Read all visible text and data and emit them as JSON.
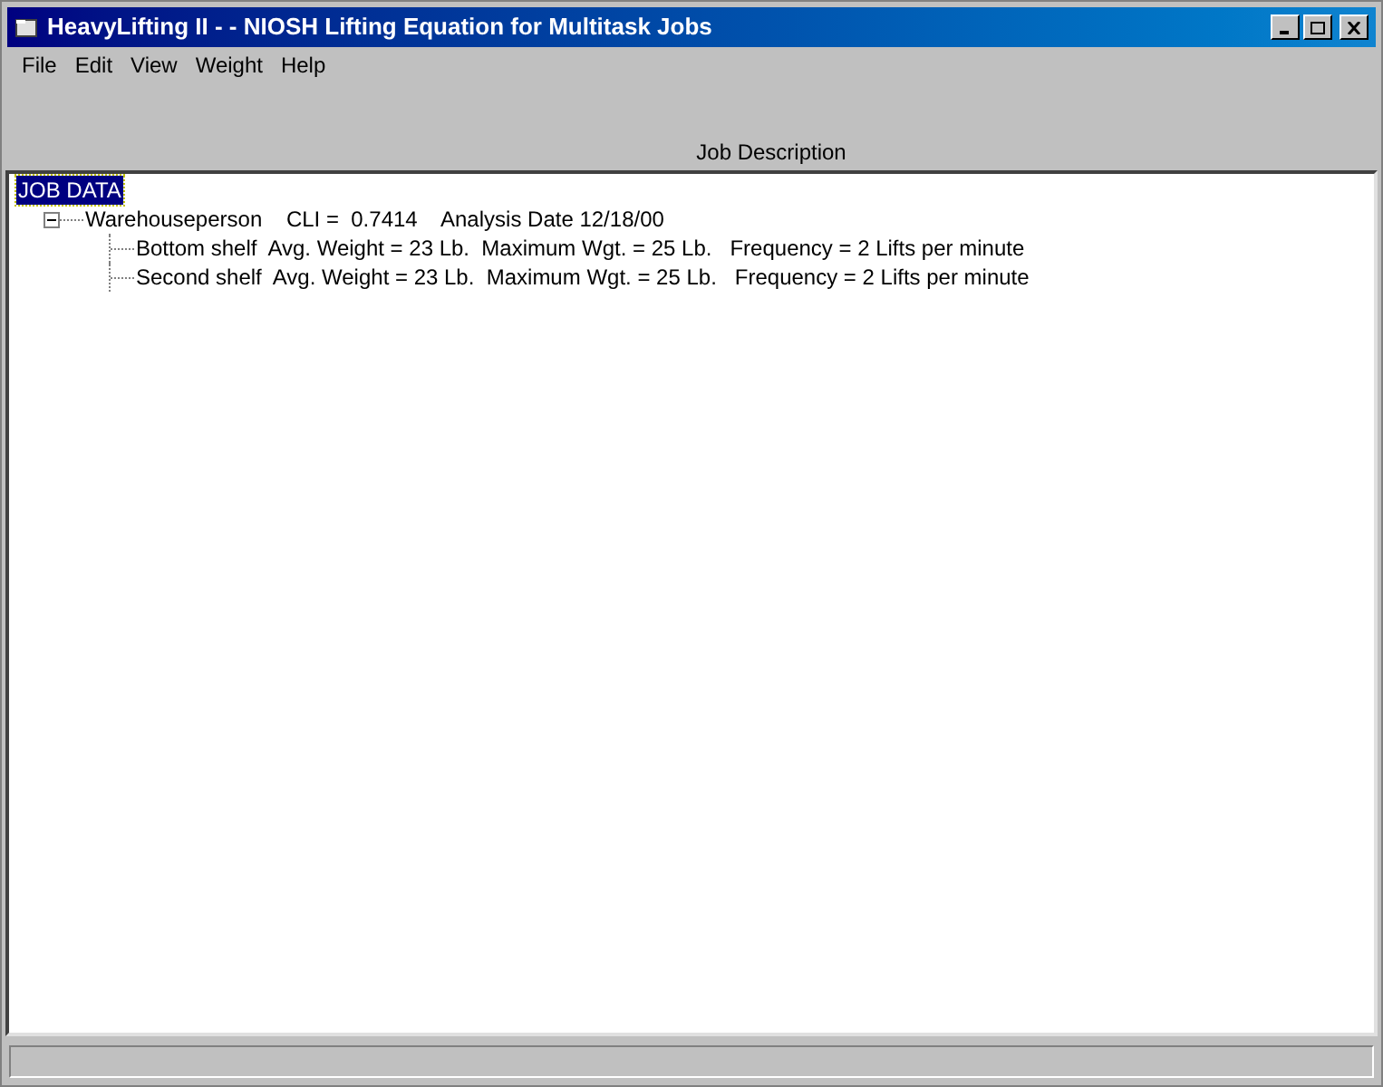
{
  "window": {
    "title": "HeavyLifting II - - NIOSH Lifting Equation for Multitask Jobs"
  },
  "menu": [
    "File",
    "Edit",
    "View",
    "Weight",
    "Help"
  ],
  "header_label": "Job Description",
  "tree": [
    {
      "label": "JOB DATA",
      "selected": true,
      "children": [
        {
          "label": "Warehouseperson    CLI =  0.7414    Analysis Date 12/18/00",
          "selected": false,
          "expanded": true,
          "children": [
            {
              "label": "Bottom shelf  Avg. Weight = 23 Lb.  Maximum Wgt. = 25 Lb.   Frequency = 2 Lifts per minute",
              "selected": false
            },
            {
              "label": "Second shelf  Avg. Weight = 23 Lb.  Maximum Wgt. = 25 Lb.   Frequency = 2 Lifts per minute",
              "selected": false
            }
          ]
        }
      ]
    }
  ]
}
